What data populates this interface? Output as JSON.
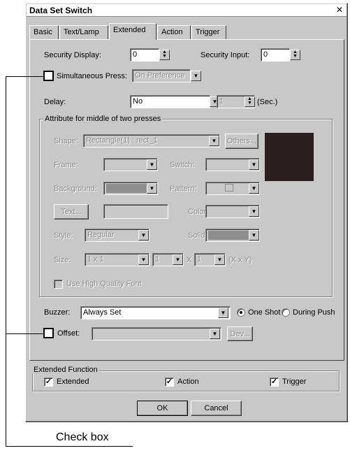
{
  "window": {
    "title": "Data Set Switch",
    "close_glyph": "✕"
  },
  "tabs": [
    {
      "label": "Basic"
    },
    {
      "label": "Text/Lamp"
    },
    {
      "label": "Extended"
    },
    {
      "label": "Action"
    },
    {
      "label": "Trigger"
    }
  ],
  "security": {
    "display_label": "Security Display:",
    "display_value": "0",
    "input_label": "Security Input:",
    "input_value": "0"
  },
  "simultaneous": {
    "label": "Simultaneous Press:",
    "value": "On Preference"
  },
  "delay": {
    "label": "Delay:",
    "value": "No",
    "seconds": "1",
    "unit": "(Sec.)"
  },
  "attribute": {
    "title": "Attribute for middle of two presses",
    "shape_label": "Shape:",
    "shape_value": "Rectangle(1) : rect_1",
    "others_button": "Others...",
    "frame_label": "Frame:",
    "switch_label": "Switch:",
    "background_label": "Background:",
    "pattern_label": "Pattern:",
    "text_button": "Text...",
    "color_label": "Color:",
    "style_label": "Style:",
    "style_value": "Regular",
    "solid_label": "Solid:",
    "size_label": "Size:",
    "size_value": "1 x 1",
    "size_x": "1",
    "times": "X",
    "size_y": "1",
    "size_unit": "(X x Y)",
    "hq_font_label": "Use High Quality Font",
    "preview_color": "#2a1e1e"
  },
  "buzzer": {
    "label": "Buzzer:",
    "value": "Always Set",
    "one_shot": "One Shot",
    "during_push": "During Push"
  },
  "offset": {
    "label": "Offset:",
    "dev_button": "Dev..."
  },
  "extended_function": {
    "title": "Extended Function",
    "extended": "Extended",
    "action": "Action",
    "trigger": "Trigger"
  },
  "buttons": {
    "ok": "OK",
    "cancel": "Cancel"
  },
  "annotation": {
    "caption": "Check box"
  }
}
